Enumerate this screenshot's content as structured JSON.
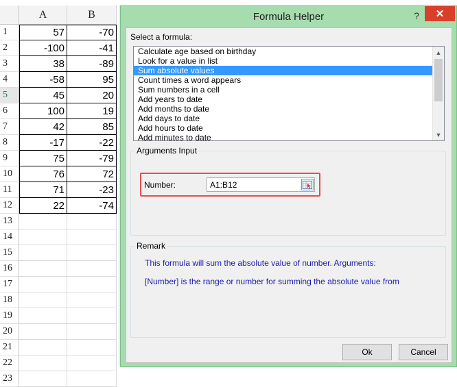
{
  "sheet": {
    "columns": [
      "A",
      "B"
    ],
    "rows": [
      {
        "n": "1",
        "a": "57",
        "b": "-70"
      },
      {
        "n": "2",
        "a": "-100",
        "b": "-41"
      },
      {
        "n": "3",
        "a": "38",
        "b": "-89"
      },
      {
        "n": "4",
        "a": "-58",
        "b": "95"
      },
      {
        "n": "5",
        "a": "45",
        "b": "20"
      },
      {
        "n": "6",
        "a": "100",
        "b": "19"
      },
      {
        "n": "7",
        "a": "42",
        "b": "85"
      },
      {
        "n": "8",
        "a": "-17",
        "b": "-22"
      },
      {
        "n": "9",
        "a": "75",
        "b": "-79"
      },
      {
        "n": "10",
        "a": "76",
        "b": "72"
      },
      {
        "n": "11",
        "a": "71",
        "b": "-23"
      },
      {
        "n": "12",
        "a": "22",
        "b": "-74"
      },
      {
        "n": "13",
        "a": "",
        "b": ""
      },
      {
        "n": "14",
        "a": "",
        "b": ""
      },
      {
        "n": "15",
        "a": "",
        "b": ""
      },
      {
        "n": "16",
        "a": "",
        "b": ""
      },
      {
        "n": "17",
        "a": "",
        "b": ""
      },
      {
        "n": "18",
        "a": "",
        "b": ""
      },
      {
        "n": "19",
        "a": "",
        "b": ""
      },
      {
        "n": "20",
        "a": "",
        "b": ""
      },
      {
        "n": "21",
        "a": "",
        "b": ""
      },
      {
        "n": "22",
        "a": "",
        "b": ""
      },
      {
        "n": "23",
        "a": "",
        "b": ""
      }
    ]
  },
  "dialog": {
    "title": "Formula Helper",
    "help_icon": "?",
    "close_icon": "✕",
    "select_label": "Select a formula:",
    "formulas": [
      "Calculate age based on birthday",
      "Look for a value in list",
      "Sum absolute values",
      "Count times a word appears",
      "Sum numbers in a cell",
      "Add years to date",
      "Add months to date",
      "Add days to date",
      "Add hours to date",
      "Add minutes to date"
    ],
    "selected_formula": "Sum absolute values",
    "arguments_legend": "Arguments Input",
    "number_label": "Number:",
    "number_value": "A1:B12",
    "remark_legend": "Remark",
    "remark_line1": "This formula will sum the absolute value of number. Arguments:",
    "remark_line2": "[Number] is the range or number for summing the absolute value from",
    "ok_label": "Ok",
    "cancel_label": "Cancel"
  },
  "colors": {
    "dialog_frame": "#a7dcae",
    "selection": "#3399ff",
    "remark_text": "#1b1bb0",
    "highlight_box": "#e05050",
    "close_button": "#d9402b"
  }
}
